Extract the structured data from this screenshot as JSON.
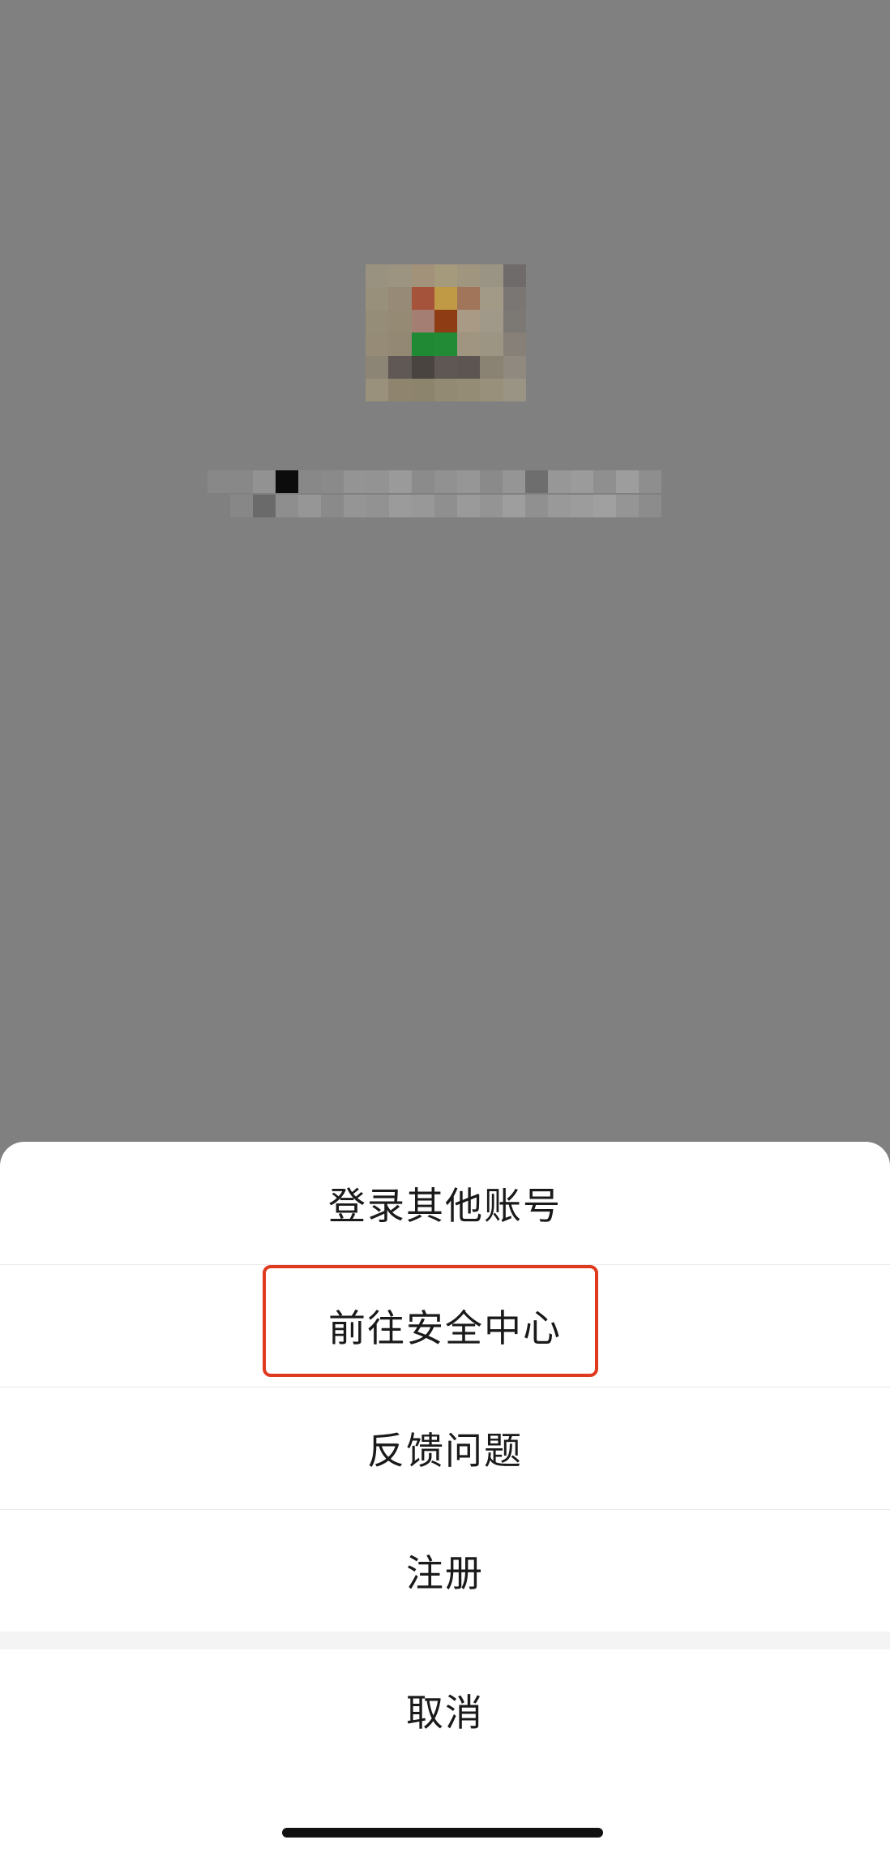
{
  "colors": {
    "overlay": "#808080",
    "sheet_background": "#ffffff",
    "highlight_border": "#e03a1e",
    "text": "#1a1a1a"
  },
  "background": {
    "avatar_icon": "pixelated-avatar",
    "account_name_icon": "pixelated-account-name"
  },
  "action_sheet": {
    "items": [
      {
        "label": "登录其他账号"
      },
      {
        "label": "前往安全中心"
      },
      {
        "label": "反馈问题"
      },
      {
        "label": "注册"
      }
    ],
    "cancel_label": "取消"
  }
}
